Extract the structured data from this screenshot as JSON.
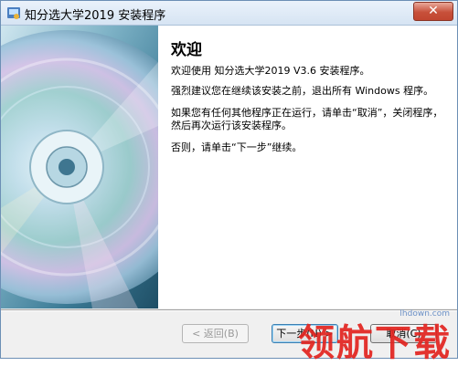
{
  "window": {
    "title": "知分选大学2019 安装程序",
    "close_label": "✕"
  },
  "welcome": {
    "heading": "欢迎",
    "line1": "欢迎使用 知分选大学2019 V3.6 安装程序。",
    "line2": "强烈建议您在继续该安装之前，退出所有 Windows 程序。",
    "line3": "如果您有任何其他程序正在运行，请单击“取消”，关闭程序，然后再次运行该安装程序。",
    "line4": "否则，请单击“下一步”继续。"
  },
  "buttons": {
    "back": "< 返回(B)",
    "next": "下一步(N) >",
    "cancel": "取消(C)"
  },
  "watermark": {
    "text": "领航下载",
    "url": "lhdown.com"
  }
}
